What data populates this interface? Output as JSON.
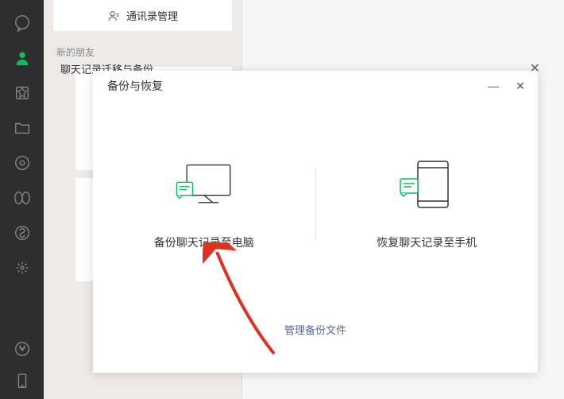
{
  "sidebar": {
    "items": [
      "chat",
      "contacts",
      "favorites",
      "files",
      "moments",
      "channels",
      "miniprograms",
      "search"
    ],
    "bottom": [
      "miniprog",
      "phone"
    ]
  },
  "left_panel": {
    "contact_management": "通讯录管理",
    "new_friends": "新的朋友"
  },
  "outer_dialog": {
    "title": "聊天记录迁移与备份"
  },
  "dialog": {
    "title": "备份与恢复",
    "backup_to_pc": "备份聊天记录至电脑",
    "restore_to_phone": "恢复聊天记录至手机",
    "manage_files": "管理备份文件"
  }
}
